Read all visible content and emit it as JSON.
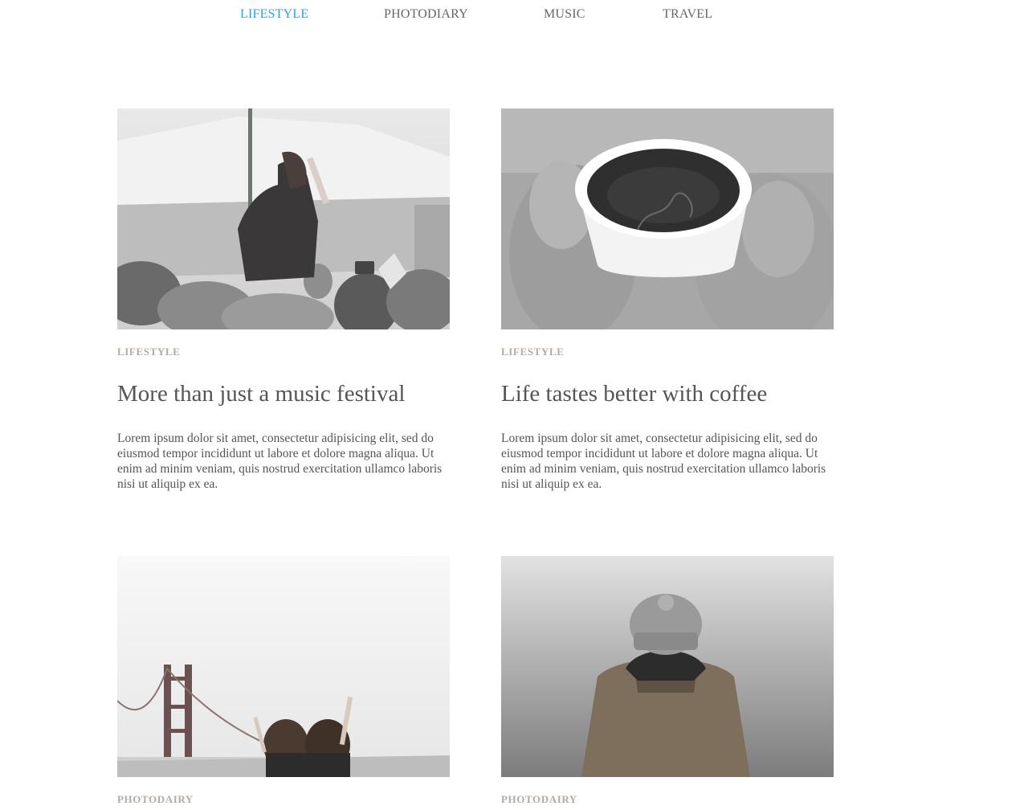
{
  "nav": {
    "items": [
      {
        "label": "LIFESTYLE",
        "active": true
      },
      {
        "label": "PHOTODIARY",
        "active": false
      },
      {
        "label": "MUSIC",
        "active": false
      },
      {
        "label": "TRAVEL",
        "active": false
      }
    ]
  },
  "colors": {
    "nav_active": "#2b9fe6",
    "nav_text": "#666666",
    "category": "#b4aba0",
    "text": "#555555"
  },
  "posts": [
    {
      "image": "festival-crowd-photo",
      "category": "LIFESTYLE",
      "title": "More than just a music festival",
      "excerpt": "Lorem ipsum dolor sit amet, consectetur adipisicing elit, sed do eiusmod tempor incididunt ut labore et dolore magna aliqua. Ut enim ad minim veniam, quis nostrud exercitation ullamco laboris nisi ut aliquip ex ea."
    },
    {
      "image": "coffee-cup-mittens-photo",
      "category": "LIFESTYLE",
      "title": "Life tastes better with coffee",
      "excerpt": "Lorem ipsum dolor sit amet, consectetur adipisicing elit, sed do eiusmod tempor incididunt ut labore et dolore magna aliqua. Ut enim ad minim veniam, quis nostrud exercitation ullamco laboris nisi ut aliquip ex ea."
    },
    {
      "image": "golden-gate-bridge-friends-photo",
      "category": "PHOTODAIRY",
      "title": "",
      "excerpt": ""
    },
    {
      "image": "person-in-beanie-fog-photo",
      "category": "PHOTODAIRY",
      "title": "",
      "excerpt": ""
    }
  ]
}
